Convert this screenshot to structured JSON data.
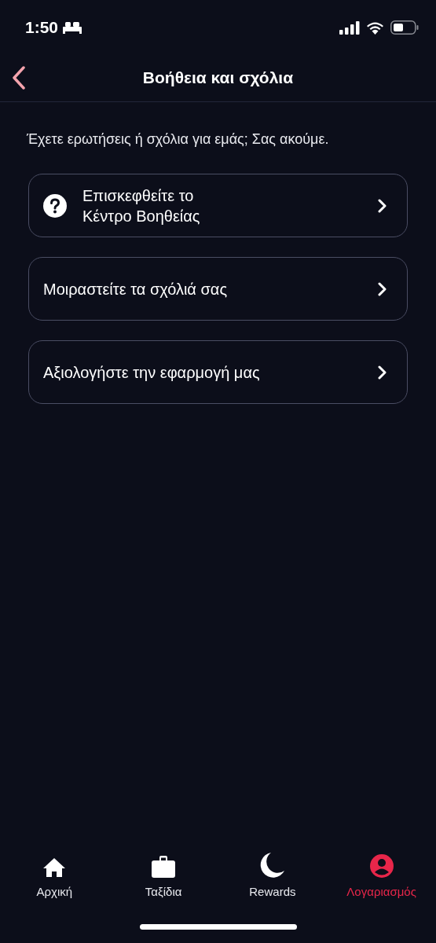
{
  "status_bar": {
    "time": "1:50"
  },
  "header": {
    "title": "Βοήθεια και σχόλια"
  },
  "intro": "Έχετε ερωτήσεις ή σχόλια για εμάς; Σας ακούμε.",
  "items": [
    {
      "label": "Επισκεφθείτε το Κέντρο Βοηθείας",
      "kind": "help"
    },
    {
      "label": "Μοιραστείτε τα σχόλιά σας",
      "kind": "plain"
    },
    {
      "label": "Αξιολογήστε την εφαρμογή μας",
      "kind": "plain"
    }
  ],
  "tabs": [
    {
      "label": "Αρχική",
      "kind": "home",
      "selected": false
    },
    {
      "label": "Ταξίδια",
      "kind": "trips",
      "selected": false
    },
    {
      "label": "Rewards",
      "kind": "rewards",
      "selected": false
    },
    {
      "label": "Λογαριασμός",
      "kind": "account",
      "selected": true
    }
  ]
}
